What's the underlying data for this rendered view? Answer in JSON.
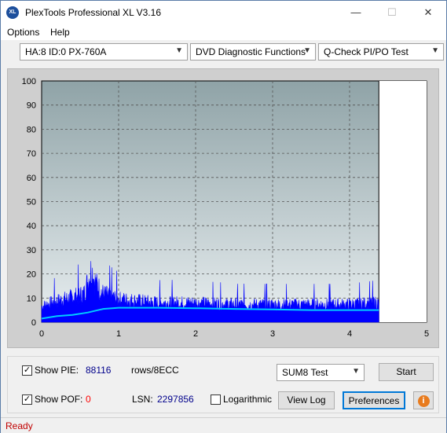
{
  "window": {
    "title": "PlexTools Professional XL V3.16",
    "app_icon_text": "XL",
    "min_glyph": "—",
    "max_glyph": "☐",
    "close_glyph": "✕"
  },
  "menu": {
    "options": "Options",
    "help": "Help"
  },
  "toolbar": {
    "drive": "HA:8 ID:0  PX-760A",
    "function": "DVD Diagnostic Functions",
    "test": "Q-Check PI/PO Test"
  },
  "chart_data": {
    "type": "bar",
    "xlim": [
      0,
      5
    ],
    "ylim": [
      0,
      100
    ],
    "xticks": [
      "0",
      "1",
      "2",
      "3",
      "4",
      "5"
    ],
    "yticks": [
      "0",
      "10",
      "20",
      "30",
      "40",
      "50",
      "60",
      "70",
      "80",
      "90",
      "100"
    ],
    "data_end_x": 4.38,
    "grid": true,
    "series": [
      {
        "color": "#0000ff",
        "x": [
          0.0,
          0.2,
          0.4,
          0.55,
          0.65,
          0.7,
          0.8,
          1.0,
          1.5,
          2.0,
          2.5,
          3.0,
          3.5,
          4.0,
          4.38
        ],
        "y": [
          9,
          12,
          14,
          16,
          30,
          22,
          16,
          13,
          11,
          11,
          10,
          10,
          10,
          10,
          11
        ]
      },
      {
        "color": "#00ccff",
        "x": [
          0.0,
          0.2,
          0.4,
          0.6,
          0.8,
          1.0,
          1.5,
          2.0,
          2.5,
          3.0,
          3.5,
          4.0,
          4.38
        ],
        "y": [
          1.5,
          2.5,
          3,
          4,
          5.5,
          6,
          6,
          5.8,
          5.5,
          5.3,
          5,
          5,
          5
        ]
      }
    ]
  },
  "panel": {
    "show_pie_label": "Show PIE:",
    "pie_value": "88116",
    "rows_label": "rows/8ECC",
    "show_pof_label": "Show POF:",
    "pof_value": "0",
    "lsn_label": "LSN:",
    "lsn_value": "2297856",
    "logarithmic_label": "Logarithmic",
    "test_mode": "SUM8 Test",
    "start_label": "Start",
    "view_log_label": "View Log",
    "preferences_label": "Preferences",
    "info_glyph": "i",
    "check_glyph": "✓"
  },
  "status": {
    "text": "Ready"
  },
  "colors": {
    "pie_value": "#00008b",
    "pof_value": "#ff0000",
    "status": "#c00000",
    "plot_bg": "#8fa3a7"
  }
}
